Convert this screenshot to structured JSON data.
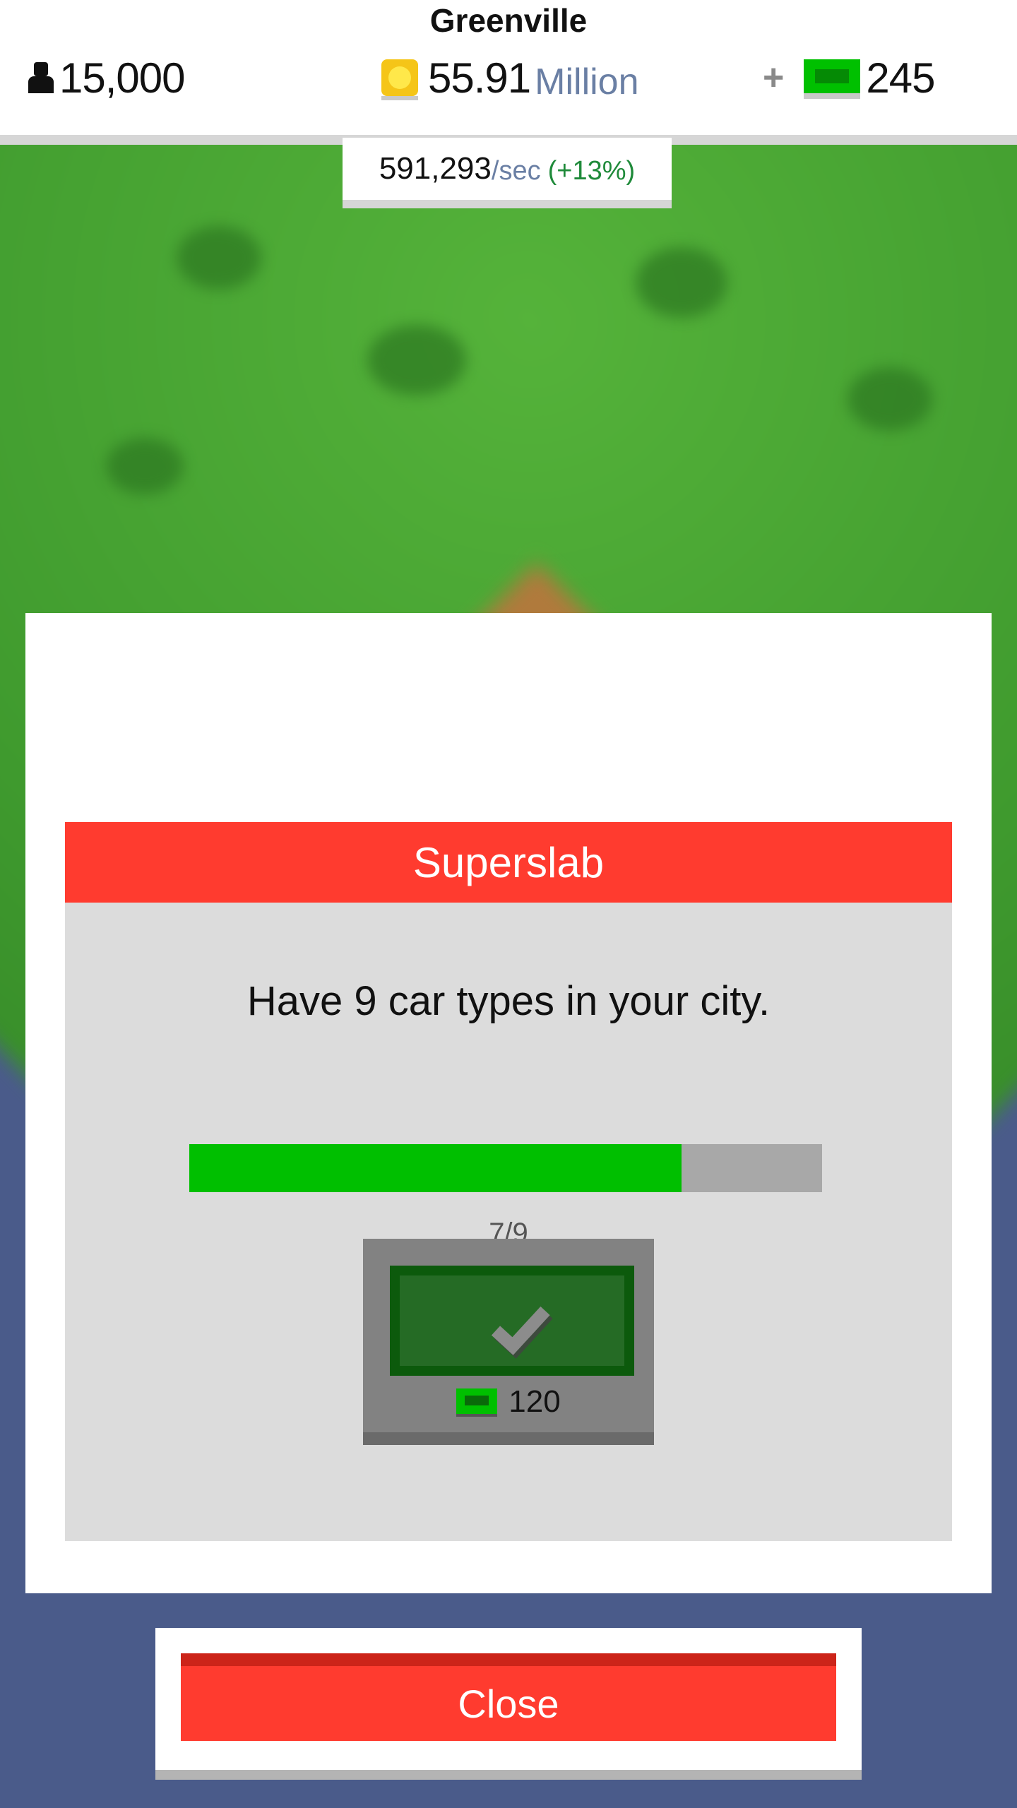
{
  "hud": {
    "city_name": "Greenville",
    "population": "15,000",
    "money_value": "55.91",
    "money_unit": "Million",
    "plus": "+",
    "cash": "245",
    "rate_value": "591,293",
    "rate_unit": "/sec",
    "rate_bonus": "(+13%)"
  },
  "achievement": {
    "title": "Superslab",
    "description": "Have 9 car types in your city.",
    "progress": {
      "current": 7,
      "total": 9,
      "fraction": 0.778
    },
    "progress_text": "7/9",
    "reward_amount": "120",
    "completed_icon": "checkmark-icon"
  },
  "buttons": {
    "close": "Close"
  },
  "colors": {
    "accent_red": "#ff3b2f",
    "progress_green": "#00bf00",
    "cash_green": "#00c000",
    "coin_yellow": "#f5c518",
    "rate_bonus_green": "#1f8a3a"
  }
}
